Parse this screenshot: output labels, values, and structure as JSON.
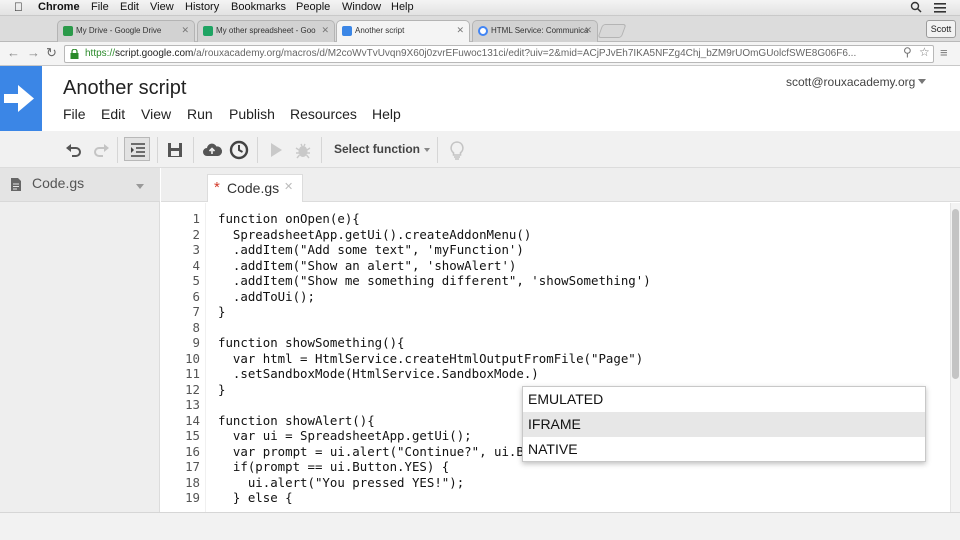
{
  "macos_menubar": {
    "app": "Chrome",
    "items": [
      "File",
      "Edit",
      "View",
      "History",
      "Bookmarks",
      "People",
      "Window",
      "Help"
    ]
  },
  "browser": {
    "tabs": [
      {
        "title": "My Drive - Google Drive",
        "favicon": "drive-icon",
        "color": "#2b9a4a"
      },
      {
        "title": "My other spreadsheet - Goo",
        "favicon": "sheets-icon",
        "color": "#1fa463"
      },
      {
        "title": "Another script",
        "favicon": "apps-script-icon",
        "color": "#3b86e6",
        "active": true
      },
      {
        "title": "HTML Service: Communica",
        "favicon": "google-icon",
        "color": "#4285f4"
      }
    ],
    "profile": "Scott",
    "url": {
      "scheme": "https://",
      "domain": "script.google.com",
      "path": "/a/rouxacademy.org/macros/d/M2coWvTvUvqn9X60j0zvrEFuwoc131ci/edit?uiv=2&mid=ACjPJvEh7IKA5NFZg4Chj_bZM9rUOmGUolcfSWE8G06F6..."
    }
  },
  "app": {
    "project_title": "Another script",
    "account": "scott@rouxacademy.org",
    "accent": "#3b86e6",
    "menus": [
      "File",
      "Edit",
      "View",
      "Run",
      "Publish",
      "Resources",
      "Help"
    ],
    "toolbar": {
      "icons": [
        "undo-icon",
        "redo-icon",
        "indent-icon",
        "save-icon",
        "publish-cloud-icon",
        "triggers-clock-icon",
        "run-play-icon",
        "debug-bug-icon",
        "lightbulb-icon"
      ],
      "select_function": "Select function"
    }
  },
  "sidebar": {
    "file": "Code.gs"
  },
  "editor": {
    "tab": {
      "label": "Code.gs",
      "modified_marker": "*"
    },
    "lines": [
      {
        "n": "1",
        "text": "function onOpen(e){"
      },
      {
        "n": "2",
        "text": "  SpreadsheetApp.getUi().createAddonMenu()"
      },
      {
        "n": "3",
        "text": "  .addItem(\"Add some text\", 'myFunction')"
      },
      {
        "n": "4",
        "text": "  .addItem(\"Show an alert\", 'showAlert')"
      },
      {
        "n": "5",
        "text": "  .addItem(\"Show me something different\", 'showSomething')"
      },
      {
        "n": "6",
        "text": "  .addToUi();"
      },
      {
        "n": "7",
        "text": "}"
      },
      {
        "n": "8",
        "text": ""
      },
      {
        "n": "9",
        "text": "function showSomething(){"
      },
      {
        "n": "10",
        "text": "  var html = HtmlService.createHtmlOutputFromFile(\"Page\")"
      },
      {
        "n": "11",
        "text": "  .setSandboxMode(HtmlService.SandboxMode.)"
      },
      {
        "n": "12",
        "text": "}"
      },
      {
        "n": "13",
        "text": ""
      },
      {
        "n": "14",
        "text": "function showAlert(){"
      },
      {
        "n": "15",
        "text": "  var ui = SpreadsheetApp.getUi();"
      },
      {
        "n": "16",
        "text": "  var prompt = ui.alert(\"Continue?\", ui.B"
      },
      {
        "n": "17",
        "text": "  if(prompt == ui.Button.YES) {"
      },
      {
        "n": "18",
        "text": "    ui.alert(\"You pressed YES!\");"
      },
      {
        "n": "19",
        "text": "  } else {"
      }
    ],
    "autocomplete": {
      "options": [
        "EMULATED",
        "IFRAME",
        "NATIVE"
      ],
      "selected_index": 1
    }
  }
}
